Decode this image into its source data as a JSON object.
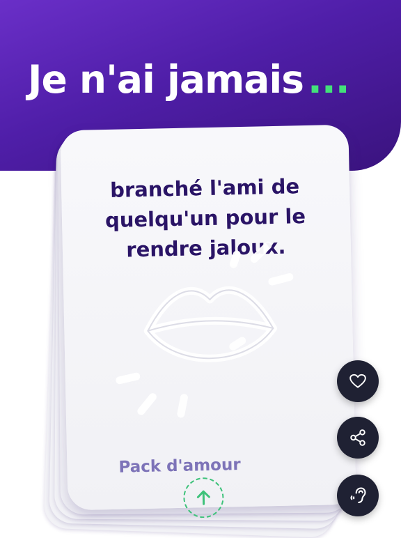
{
  "header": {
    "title": "Je n'ai jamais",
    "dots": "...",
    "accent_color": "#43e07a"
  },
  "card": {
    "statement": "branché l'ami de quelqu'un pour le rendre jaloux.",
    "illustration_icon": "lips-icon",
    "pack_label": "Pack d'amour",
    "swipe_icon": "arrow-up-icon"
  },
  "actions": [
    {
      "icon": "heart-icon"
    },
    {
      "icon": "share-icon"
    },
    {
      "icon": "hearing-icon"
    }
  ],
  "colors": {
    "header_bg": "#4f1ea8",
    "card_text": "#2a1466",
    "pack_text": "#7d73b8",
    "fab_bg": "#1f2133"
  }
}
